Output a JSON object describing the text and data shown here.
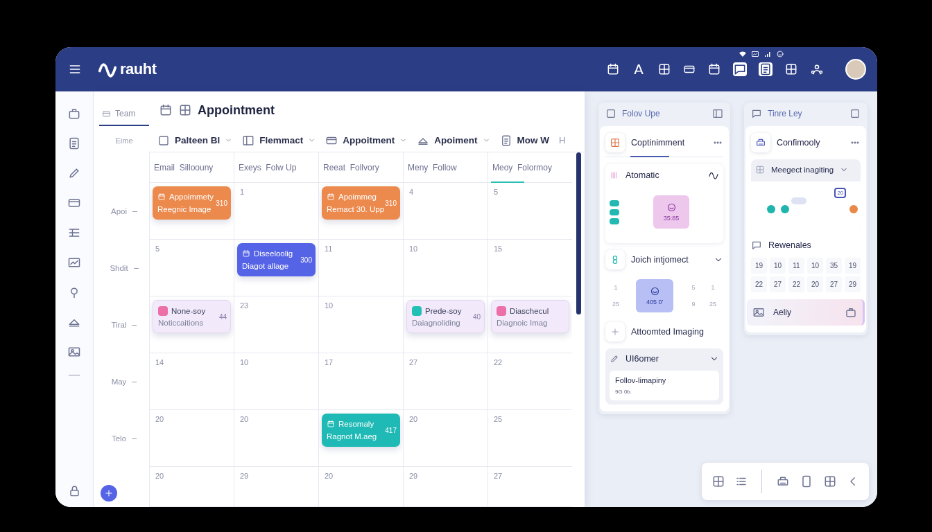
{
  "header": {
    "logo": "rauht",
    "glyph": "A"
  },
  "time_column": {
    "tab": "Team",
    "label": "Eime",
    "rows": [
      "Apoi",
      "Shdit",
      "Tiral",
      "May",
      "Telo"
    ]
  },
  "calendar": {
    "title": "Appointment",
    "filters": [
      {
        "label": "Palteen Bl",
        "dropdown": true
      },
      {
        "label": "Flemmact",
        "dropdown": true
      },
      {
        "label": "Appoitment",
        "dropdown": true
      },
      {
        "label": "Apoiment",
        "dropdown": true
      },
      {
        "label": "Mow W",
        "dropdown": false
      }
    ],
    "overflow_label": "H",
    "columns": [
      {
        "label": "Email  Silloouny",
        "selected": false
      },
      {
        "label": "Exeys  Folw Up",
        "selected": false
      },
      {
        "label": "Reeat  Follvory",
        "selected": false
      },
      {
        "label": "Meny  Follow",
        "selected": false
      },
      {
        "label": "Meoy  Folormoy",
        "selected": true
      }
    ],
    "weeks": [
      [
        {
          "event": {
            "kind": "solid",
            "color": "#ec8a4e",
            "title": "Appoimmety",
            "subtitle": "Reegnic Image",
            "time": "310"
          }
        },
        {
          "date": "1"
        },
        {
          "event": {
            "kind": "solid",
            "color": "#ec8a4e",
            "title": "Apoimmeg",
            "subtitle": "Remact 30. Upp",
            "time": "310"
          }
        },
        {
          "date": "4"
        },
        {
          "date": "5"
        }
      ],
      [
        {
          "date": "5"
        },
        {
          "event": {
            "kind": "solid",
            "color": "#5563e6",
            "title": "Diseeloolig",
            "subtitle": "Diagot allage",
            "time": "300"
          }
        },
        {
          "date": "11"
        },
        {
          "date": "10"
        },
        {
          "date": "15"
        }
      ],
      [
        {
          "event": {
            "kind": "soft",
            "color": "#ec6fa8",
            "title": "None-soy",
            "subtitle": "Noticcaitions",
            "time": "44"
          }
        },
        {
          "date": "23"
        },
        {
          "date": "10"
        },
        {
          "event": {
            "kind": "soft",
            "color": "#22bfb5",
            "title": "Prede-soy",
            "subtitle": "Daiagnoliding",
            "time": "40"
          }
        },
        {
          "event": {
            "kind": "soft",
            "color": "#ec6fa8",
            "title": "Diaschecul",
            "subtitle": "Diagnoic Imag"
          }
        }
      ],
      [
        {
          "date": "14"
        },
        {
          "date": "10"
        },
        {
          "date": "17"
        },
        {
          "date": "27"
        },
        {
          "date": "22"
        }
      ],
      [
        {
          "date": "20"
        },
        {
          "date": "20"
        },
        {
          "event": {
            "kind": "solid",
            "color": "#1fbab5",
            "title": "Resomaly",
            "subtitle": "Ragnot M.aeg",
            "time": "417"
          }
        },
        {
          "date": "20"
        },
        {
          "date": "25"
        }
      ],
      [
        {
          "date": "20"
        },
        {
          "date": "29"
        },
        {
          "date": "20"
        },
        {
          "date": "29"
        },
        {
          "date": "27"
        }
      ]
    ]
  },
  "panel_left": {
    "title": "Folov Upe",
    "heading": "Coptinimment",
    "automatic": {
      "title": "Atomatic",
      "tile": "35:85"
    },
    "project": {
      "title": "Joich intjomect",
      "tile": "405 0'",
      "numbers": [
        "1",
        "5",
        "1",
        "25",
        "9",
        "25"
      ]
    },
    "imaging": {
      "title": "Attoomted Imaging"
    },
    "group": {
      "title": "UI6omer",
      "item_title": "Follov-limapiny",
      "item_note": "9G 0b."
    }
  },
  "panel_right": {
    "title": "Tinre Ley",
    "heading": "Confimooly",
    "imaging": {
      "title": "Meegect inagiting",
      "selected_day": "20",
      "dots": [
        {
          "color": "#1fb5ad"
        },
        {
          "color": "#1fb5ad"
        },
        {
          "color": "#e8894a"
        }
      ]
    },
    "renewals": {
      "title": "Rewenales",
      "numbers": [
        "19",
        "10",
        "11",
        "10",
        "35",
        "19",
        "22",
        "27",
        "22",
        "20",
        "27",
        "29"
      ]
    },
    "footer": {
      "title": "Aeliy"
    }
  }
}
